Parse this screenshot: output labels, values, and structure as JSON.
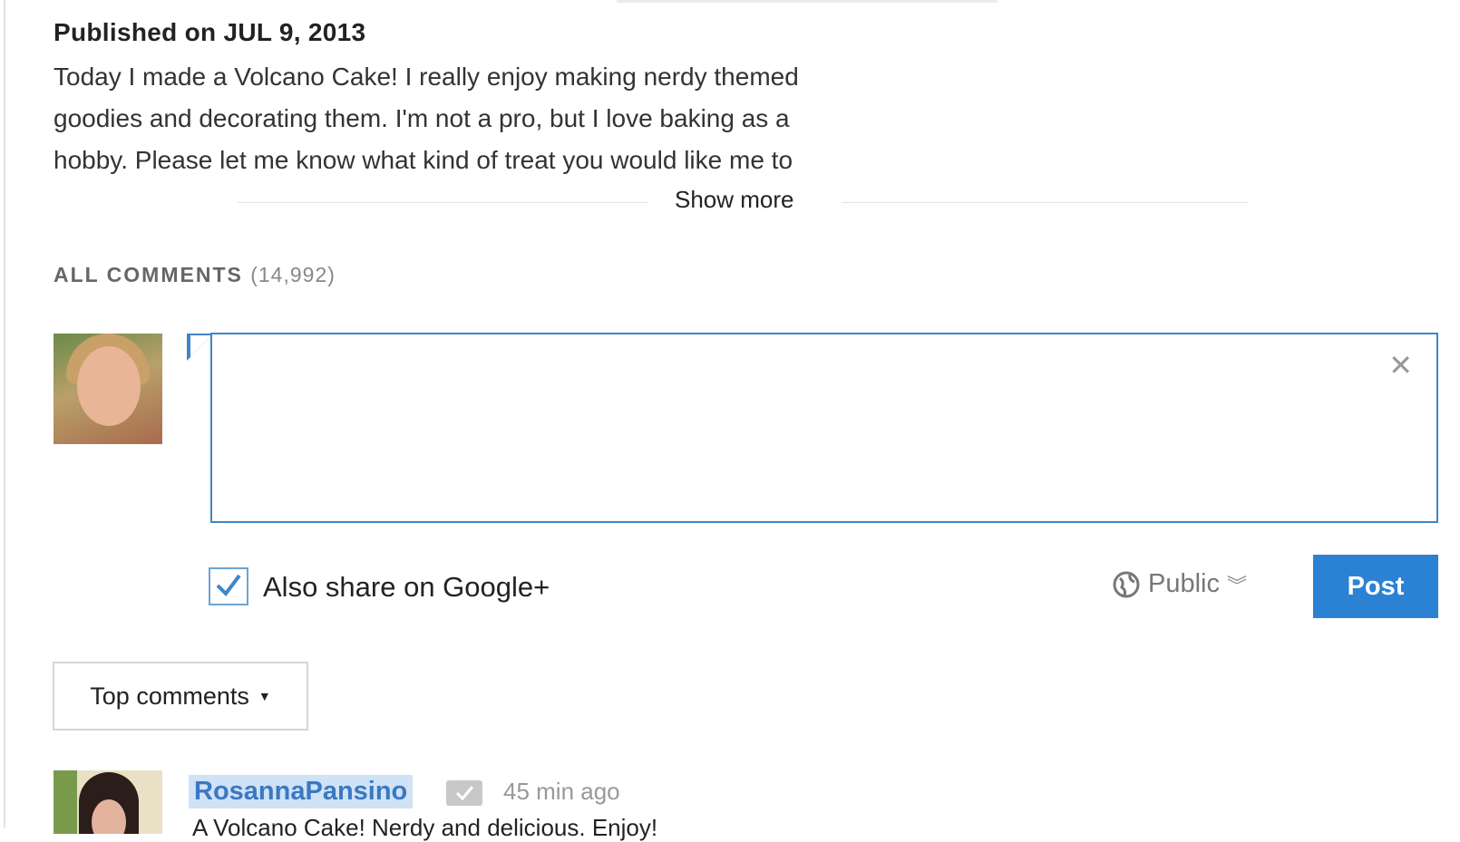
{
  "video": {
    "published": "Published on JUL 9, 2013",
    "description_lines": [
      "Today I made a Volcano Cake! I really enjoy making nerdy themed",
      "goodies and decorating them. I'm not a pro, but I love baking as a",
      "hobby. Please let me know what kind of treat you would like me to"
    ],
    "show_more": "Show more"
  },
  "comments": {
    "header": "ALL COMMENTS",
    "count": "(14,992)",
    "composer": {
      "close_icon": "close-icon",
      "share_label": "Also share on Google+",
      "share_checked": true,
      "privacy": "Public",
      "post_label": "Post"
    },
    "sort_label": "Top comments",
    "items": [
      {
        "author": "RosannaPansino",
        "time": "45 min ago",
        "text": "A Volcano Cake! Nerdy and delicious. Enjoy!"
      }
    ]
  },
  "colors": {
    "accent": "#2b82d4",
    "box_border": "#3c86c9",
    "author_highlight": "#cfe2f6"
  }
}
